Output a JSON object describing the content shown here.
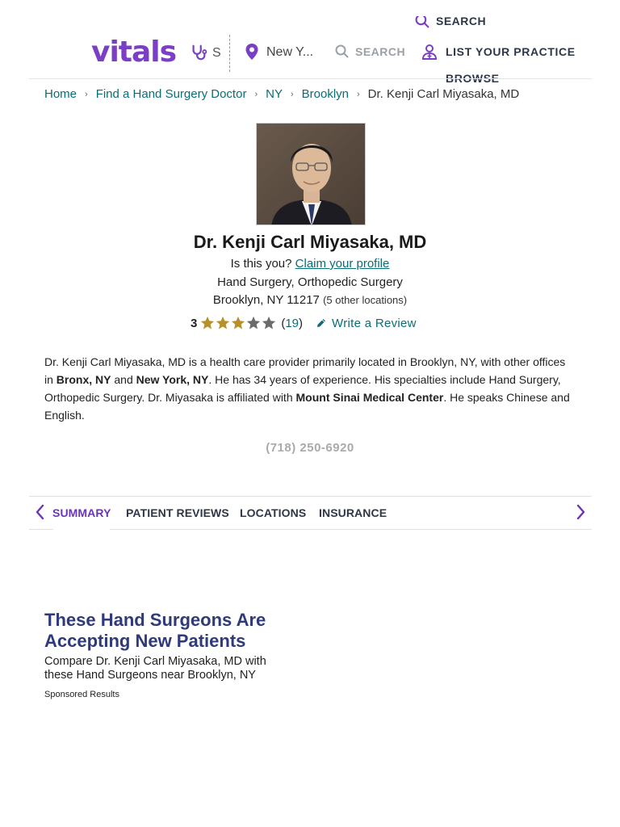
{
  "header": {
    "logo": "vitals",
    "search_partial": "S",
    "location_value": "New Y...",
    "search_label": "SEARCH",
    "search_top_label": "SEARCH",
    "list_practice_label": "LIST YOUR PRACTICE",
    "browse_label": "BROWSE"
  },
  "breadcrumb": {
    "items": [
      "Home",
      "Find a Hand Surgery Doctor",
      "NY",
      "Brooklyn"
    ],
    "current": "Dr. Kenji Carl Miyasaka, MD"
  },
  "profile": {
    "name": "Dr. Kenji Carl Miyasaka, MD",
    "claim_prefix": "Is this you?",
    "claim_link": "Claim your profile",
    "specialties": "Hand Surgery, Orthopedic Surgery",
    "location": "Brooklyn, NY 11217",
    "other_locations": "(5 other locations)",
    "rating": "3",
    "rating_value": 3,
    "rating_max": 5,
    "review_count": "19",
    "write_review": "Write a Review",
    "phone": "(718) 250-6920"
  },
  "bio": {
    "p1": "Dr. Kenji Carl Miyasaka, MD is a health care provider primarily located in Brooklyn, NY, with other offices in ",
    "loc1": "Bronx, NY",
    "and": " and ",
    "loc2": "New York, NY",
    "p2": ". He has 34 years of experience. His specialties include Hand Surgery, Orthopedic Surgery. Dr. Miyasaka is affiliated with ",
    "hospital": "Mount Sinai Medical Center",
    "p3": ". He speaks Chinese and English."
  },
  "tabs": [
    {
      "label": "SUMMARY",
      "active": true
    },
    {
      "label": "PATIENT REVIEWS",
      "active": false
    },
    {
      "label": "LOCATIONS",
      "active": false
    },
    {
      "label": "INSURANCE",
      "active": false
    }
  ],
  "promo": {
    "title": "These Hand Surgeons Are Accepting New Patients",
    "subtitle": "Compare Dr. Kenji Carl Miyasaka, MD with these Hand Surgeons near Brooklyn, NY",
    "sponsored": "Sponsored Results"
  },
  "colors": {
    "brand_purple": "#7a3fc4",
    "link_teal": "#0a6d75",
    "star_gold": "#b8902a",
    "star_gray": "#6b6b6b",
    "promo_navy": "#2e3a7a"
  },
  "icons": [
    "stethoscope-icon",
    "map-pin-icon",
    "search-icon",
    "doctor-icon",
    "chevron-right-icon",
    "star-icon",
    "pencil-icon",
    "chevron-left-icon"
  ]
}
